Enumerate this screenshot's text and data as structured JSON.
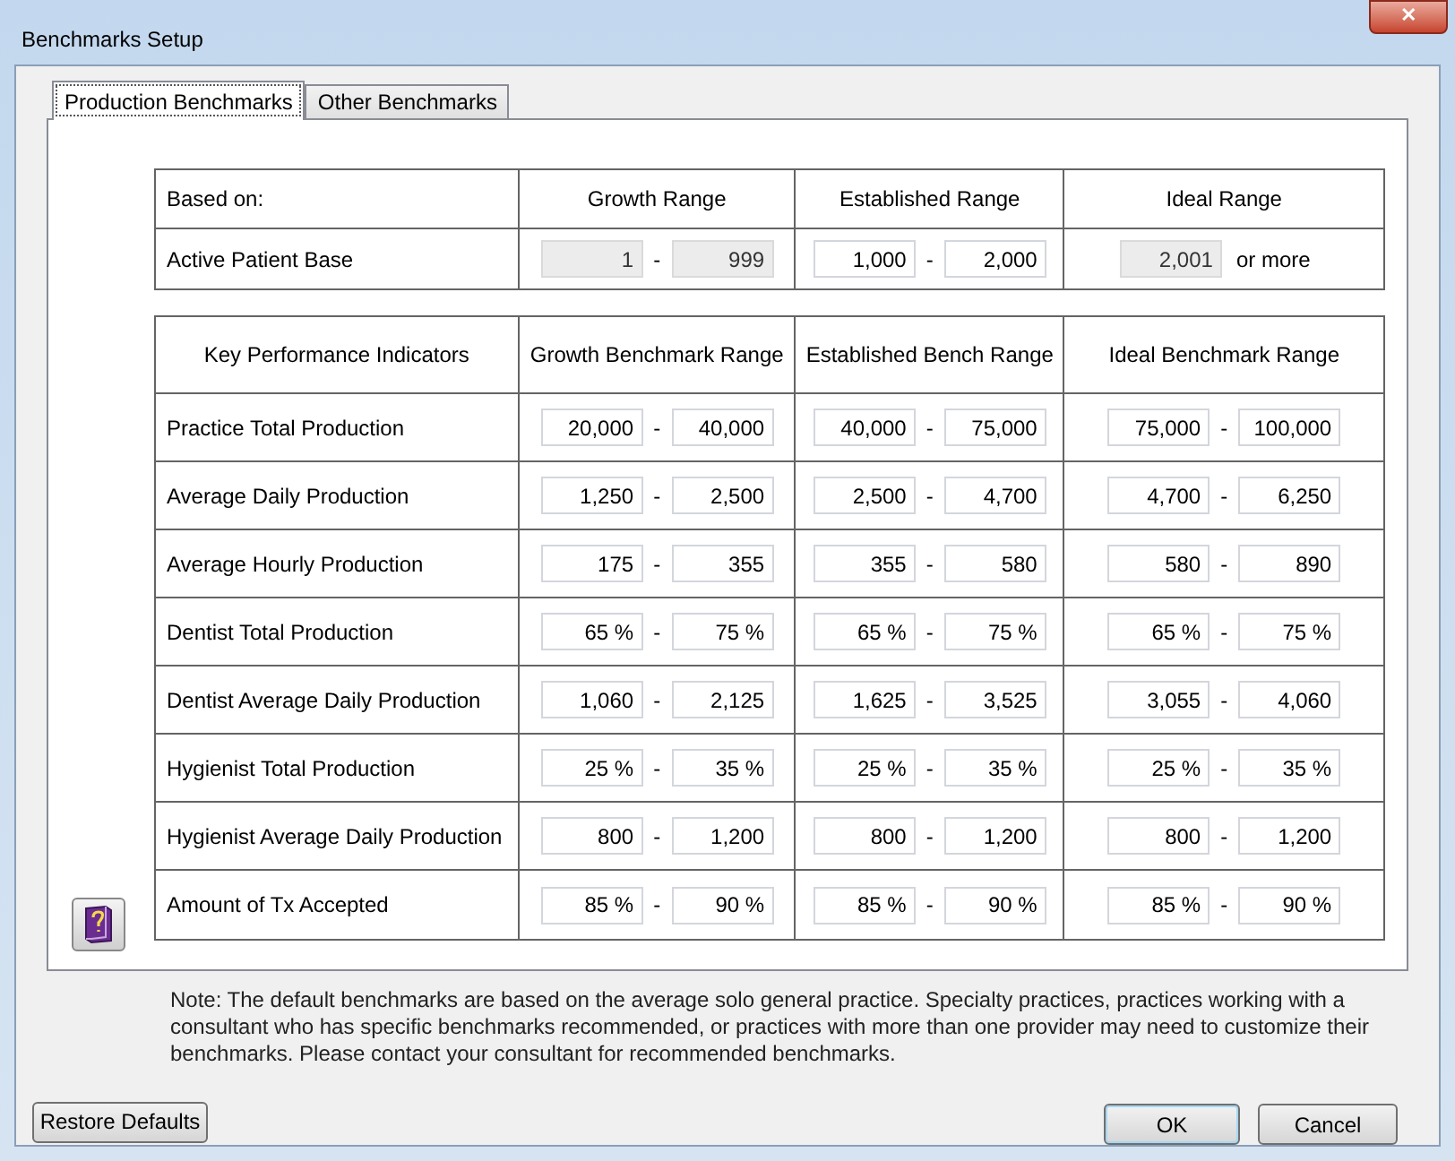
{
  "window": {
    "title": "Benchmarks Setup",
    "close": "✕"
  },
  "tabs": [
    {
      "label": "Production Benchmarks",
      "selected": true
    },
    {
      "label": "Other Benchmarks",
      "selected": false
    }
  ],
  "base_table": {
    "columns": [
      "Based on:",
      "Growth Range",
      "Established Range",
      "Ideal Range"
    ],
    "rows": [
      {
        "cells": [
          {
            "kind": "label",
            "text": "Active Patient Base"
          },
          {
            "kind": "range",
            "from": {
              "value": "1",
              "disabled": true
            },
            "to": {
              "value": "999",
              "disabled": true
            }
          },
          {
            "kind": "range",
            "from": {
              "value": "1,000",
              "disabled": false
            },
            "to": {
              "value": "2,000",
              "disabled": false
            }
          },
          {
            "kind": "minimum",
            "from": {
              "value": "2,001",
              "disabled": true
            },
            "suffix": "or more"
          }
        ]
      }
    ]
  },
  "kpi_table": {
    "columns": [
      "Key Performance Indicators",
      "Growth Benchmark Range",
      "Established Bench Range",
      "Ideal Benchmark Range"
    ],
    "rows": [
      {
        "label": "Practice Total Production",
        "ranges": [
          [
            "20,000",
            "40,000"
          ],
          [
            "40,000",
            "75,000"
          ],
          [
            "75,000",
            "100,000"
          ]
        ]
      },
      {
        "label": "Average Daily Production",
        "ranges": [
          [
            "1,250",
            "2,500"
          ],
          [
            "2,500",
            "4,700"
          ],
          [
            "4,700",
            "6,250"
          ]
        ]
      },
      {
        "label": "Average Hourly Production",
        "ranges": [
          [
            "175",
            "355"
          ],
          [
            "355",
            "580"
          ],
          [
            "580",
            "890"
          ]
        ]
      },
      {
        "label": "Dentist Total Production",
        "ranges": [
          [
            "65 %",
            "75 %"
          ],
          [
            "65 %",
            "75 %"
          ],
          [
            "65 %",
            "75 %"
          ]
        ]
      },
      {
        "label": "Dentist Average Daily Production",
        "ranges": [
          [
            "1,060",
            "2,125"
          ],
          [
            "1,625",
            "3,525"
          ],
          [
            "3,055",
            "4,060"
          ]
        ]
      },
      {
        "label": "Hygienist Total Production",
        "ranges": [
          [
            "25 %",
            "35 %"
          ],
          [
            "25 %",
            "35 %"
          ],
          [
            "25 %",
            "35 %"
          ]
        ]
      },
      {
        "label": "Hygienist Average Daily Production",
        "ranges": [
          [
            "800",
            "1,200"
          ],
          [
            "800",
            "1,200"
          ],
          [
            "800",
            "1,200"
          ]
        ]
      },
      {
        "label": "Amount of Tx Accepted",
        "ranges": [
          [
            "85 %",
            "90 %"
          ],
          [
            "85 %",
            "90 %"
          ],
          [
            "85 %",
            "90 %"
          ]
        ]
      }
    ]
  },
  "range_separator": "-",
  "note": "Note: The default benchmarks are based on the average solo general practice.  Specialty practices, practices working with a consultant who has specific benchmarks recommended, or practices with more than one provider may need to customize their benchmarks. Please contact your consultant for recommended benchmarks.",
  "buttons": [
    {
      "label": "Restore Defaults",
      "kind": "left"
    },
    {
      "label": "OK",
      "kind": "default"
    },
    {
      "label": "Cancel",
      "kind": "normal"
    }
  ]
}
